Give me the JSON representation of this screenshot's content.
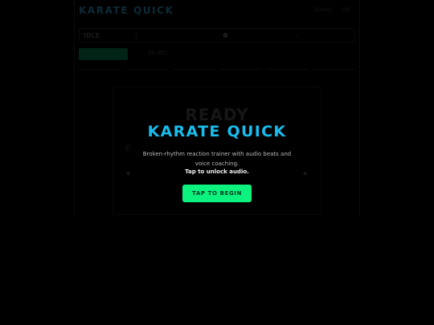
{
  "app": {
    "title": "KARATE QUICK",
    "top_right": [
      "SOUND",
      "ON"
    ],
    "status": {
      "state": "IDLE",
      "mic_icon": "mic-icon",
      "dropdown_icon": "chevron-down-icon"
    },
    "session_label": "30 SEC",
    "ready_label": "READY",
    "options": [
      "",
      "",
      "",
      "",
      "",
      ""
    ]
  },
  "overlay": {
    "title": "KARATE QUICK",
    "description": "Broken-rhythm reaction trainer with audio beats and voice coaching.",
    "unlock_hint": "Tap to unlock audio.",
    "begin_label": "TAP TO BEGIN"
  },
  "colors": {
    "background": "#000000",
    "accent_cyan": "#18bdee",
    "accent_green": "#0bf27f"
  }
}
